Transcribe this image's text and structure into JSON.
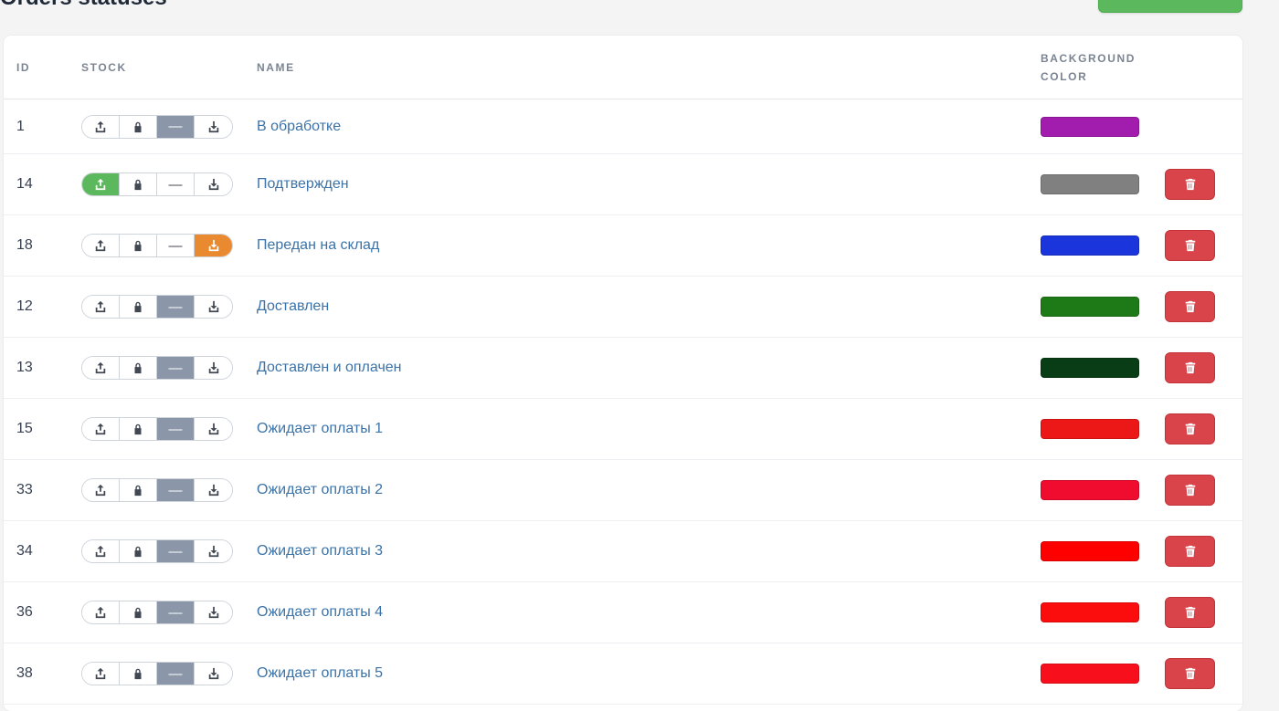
{
  "page": {
    "title": "Orders statuses"
  },
  "table": {
    "headers": {
      "id": "ID",
      "stock": "STOCK",
      "name": "NAME",
      "bg_line1": "BACKGROUND",
      "bg_line2": "COLOR"
    },
    "rows": [
      {
        "id": "1",
        "name": "В обработке",
        "stock": "none",
        "color": "#a21cae",
        "deletable": false
      },
      {
        "id": "14",
        "name": "Подтвержден",
        "stock": "out",
        "color": "#808080",
        "deletable": true
      },
      {
        "id": "18",
        "name": "Передан на склад",
        "stock": "in",
        "color": "#1a35dc",
        "deletable": true
      },
      {
        "id": "12",
        "name": "Доставлен",
        "stock": "none",
        "color": "#1e7a16",
        "deletable": true
      },
      {
        "id": "13",
        "name": "Доставлен и оплачен",
        "stock": "none",
        "color": "#083d15",
        "deletable": true
      },
      {
        "id": "15",
        "name": "Ожидает оплаты 1",
        "stock": "none",
        "color": "#ec1818",
        "deletable": true
      },
      {
        "id": "33",
        "name": "Ожидает оплаты 2",
        "stock": "none",
        "color": "#f00c2e",
        "deletable": true
      },
      {
        "id": "34",
        "name": "Ожидает оплаты 3",
        "stock": "none",
        "color": "#ff0000",
        "deletable": true
      },
      {
        "id": "36",
        "name": "Ожидает оплаты 4",
        "stock": "none",
        "color": "#fb0d0d",
        "deletable": true
      },
      {
        "id": "38",
        "name": "Ожидает оплаты 5",
        "stock": "none",
        "color": "#f7101c",
        "deletable": true
      }
    ]
  },
  "stock_options": [
    "out",
    "reserve",
    "none",
    "in"
  ],
  "stock_dash": "—",
  "icons": {
    "out": "upload-icon",
    "reserve": "lock-icon",
    "none": "dash-icon",
    "in": "download-icon",
    "delete": "trash-icon"
  },
  "colors": {
    "add_button": "#5cb85c",
    "active_out": "#5cb85c",
    "active_in": "#ea8a30",
    "active_none": "#8b97a8",
    "delete": "#d9434a",
    "link": "#3b73a9"
  }
}
